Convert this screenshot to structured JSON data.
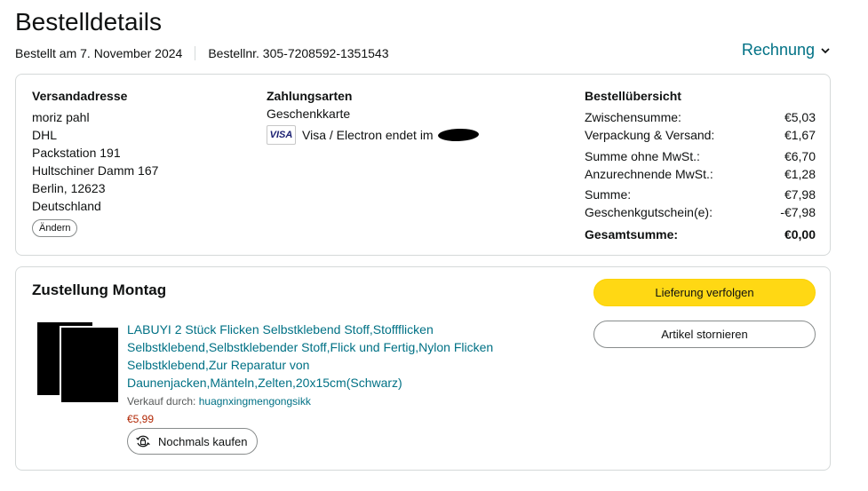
{
  "header": {
    "title": "Bestelldetails",
    "order_date": "Bestellt am 7. November 2024",
    "order_number": "Bestellnr. 305-7208592-1351543",
    "invoice_label": "Rechnung"
  },
  "shipping": {
    "heading": "Versandadresse",
    "lines": [
      "moriz pahl",
      "DHL",
      "Packstation 191",
      "Hultschiner Damm 167",
      "Berlin, 12623",
      "Deutschland"
    ],
    "change_label": "Ändern"
  },
  "payment": {
    "heading": "Zahlungsarten",
    "method_1": "Geschenkkarte",
    "card_brand": "VISA",
    "card_text": "Visa / Electron  endet im"
  },
  "summary": {
    "heading": "Bestellübersicht",
    "rows": [
      {
        "label": "Zwischensumme:",
        "value": "€5,03"
      },
      {
        "label": "Verpackung & Versand:",
        "value": "€1,67"
      },
      {
        "label": "Summe ohne MwSt.:",
        "value": "€6,70"
      },
      {
        "label": "Anzurechnende MwSt.:",
        "value": "€1,28"
      },
      {
        "label": "Summe:",
        "value": "€7,98"
      },
      {
        "label": "Geschenkgutschein(e):",
        "value": "-€7,98"
      }
    ],
    "total_label": "Gesamtsumme:",
    "total_value": "€0,00"
  },
  "delivery": {
    "title": "Zustellung Montag",
    "track_label": "Lieferung verfolgen",
    "cancel_label": "Artikel stornieren",
    "product_title": "LABUYI 2 Stück Flicken Selbstklebend Stoff,Stoffflicken Selbstklebend,Selbstklebender Stoff,Flick und Fertig,Nylon Flicken Selbstklebend,Zur Reparatur von Daunenjacken,Mänteln,Zelten,20x15cm(Schwarz)",
    "sold_by_label": "Verkauf durch:",
    "seller_name": "huagnxingmengongsikk",
    "price": "€5,99",
    "rebuy_label": "Nochmals kaufen"
  },
  "colors": {
    "link": "#007185",
    "button_yellow": "#ffd814",
    "price_red": "#b12704",
    "border": "#d5d9d9"
  }
}
